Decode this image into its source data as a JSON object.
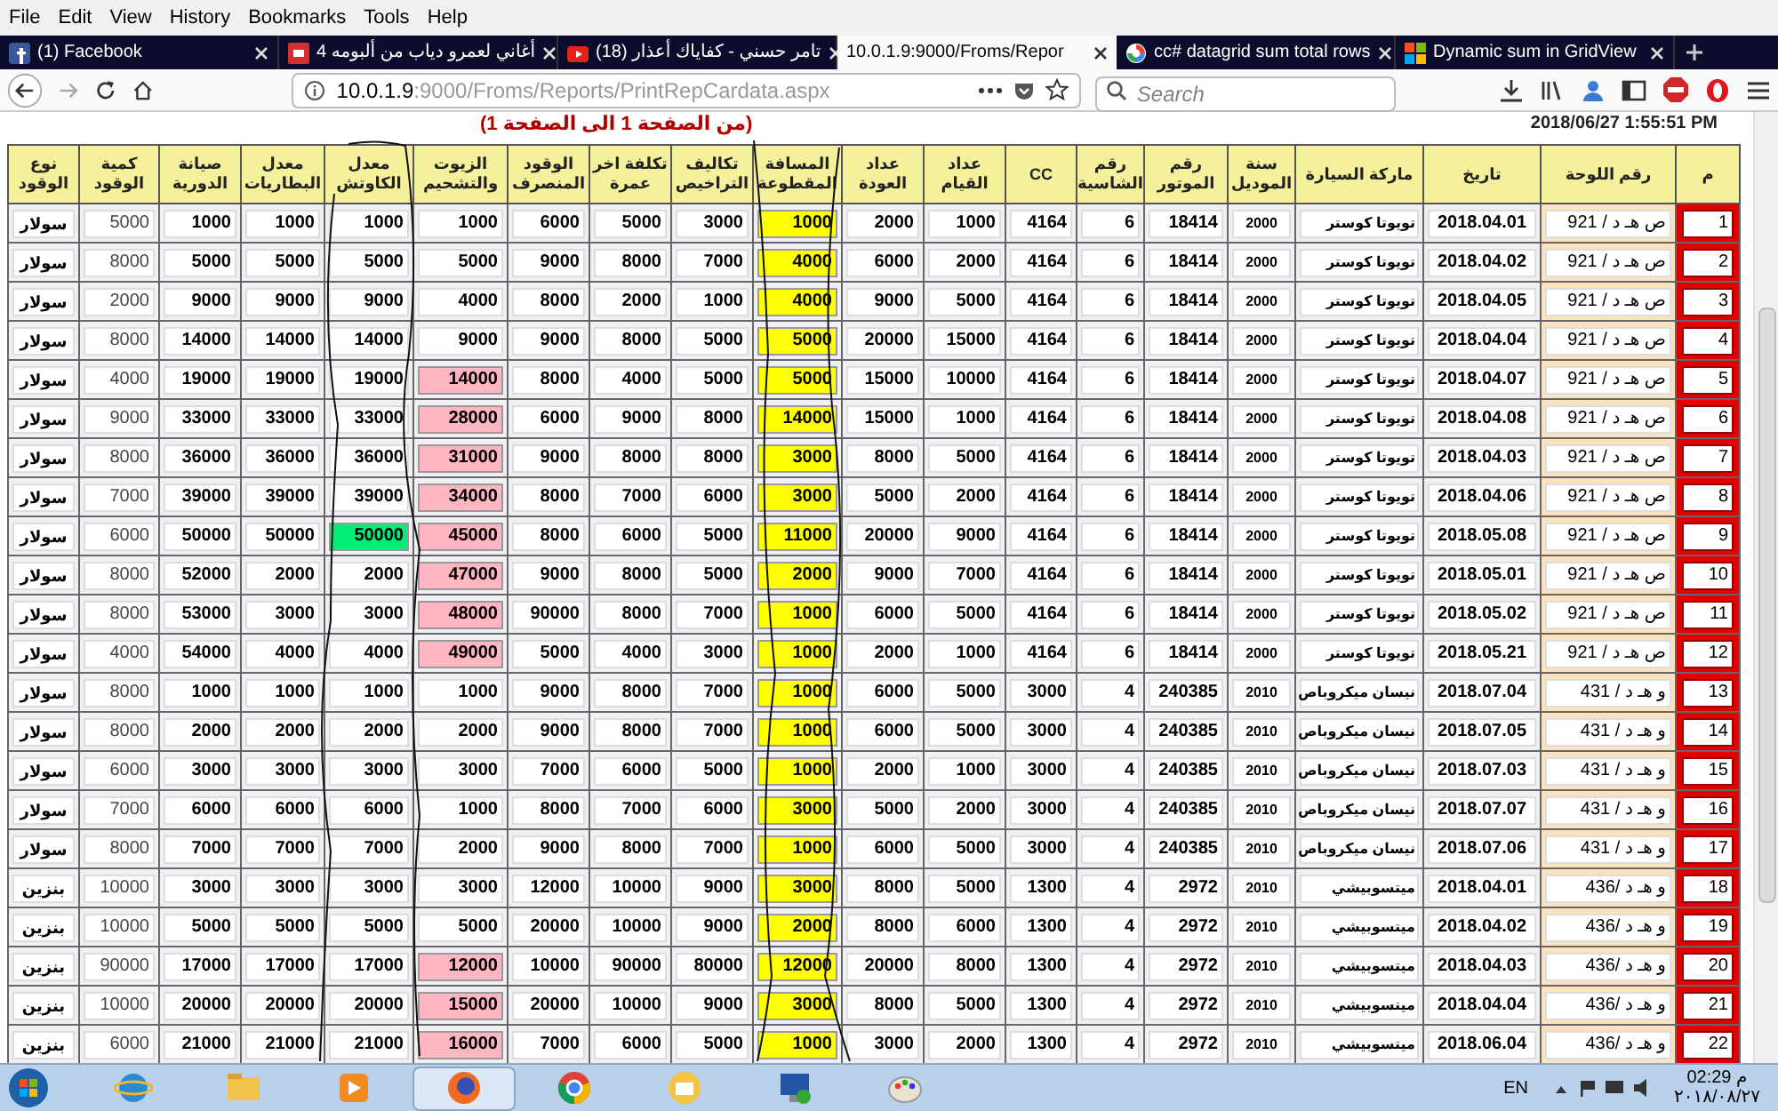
{
  "menu": [
    "File",
    "Edit",
    "View",
    "History",
    "Bookmarks",
    "Tools",
    "Help"
  ],
  "tabs": [
    {
      "label": "(1) Facebook",
      "selected": false
    },
    {
      "label": "4 أغاني لعمرو دياب من ألبومه",
      "selected": false
    },
    {
      "label": "(18) تامر حسني - كفاياك أعذار",
      "selected": false
    },
    {
      "label": "10.0.1.9:9000/Froms/Repor",
      "selected": true
    },
    {
      "label": "cc# datagrid sum total rows",
      "selected": false
    },
    {
      "label": "Dynamic sum in GridView",
      "selected": false
    }
  ],
  "address": {
    "host": "10.0.1.9",
    "rest": ":9000/Froms/Reports/PrintRepCardata.aspx"
  },
  "search": {
    "placeholder": "Search"
  },
  "report": {
    "page_range": "(من الصفحة 1 الى الصفحة 1)",
    "printed_at": "2018/06/27 1:55:51 PM"
  },
  "table": {
    "columns": [
      {
        "label": "نوع الوقود",
        "kind": "fuel"
      },
      {
        "label": "كمية الوقود",
        "kind": "plain"
      },
      {
        "label": "صيانة الدورية",
        "kind": "number"
      },
      {
        "label": "معدل البطاريات",
        "kind": "number"
      },
      {
        "label": "معدل الكاوتش",
        "kind": "tire"
      },
      {
        "label": "الزيوت والتشحيم",
        "kind": "oil"
      },
      {
        "label": "الوقود المنصرف",
        "kind": "number"
      },
      {
        "label": "تكلفة اخر عمرة",
        "kind": "number"
      },
      {
        "label": "تكاليف التراخيص",
        "kind": "number"
      },
      {
        "label": "المسافة المقطوعة",
        "kind": "highlight"
      },
      {
        "label": "عداد العودة",
        "kind": "number"
      },
      {
        "label": "عداد القيام",
        "kind": "number"
      },
      {
        "label": "CC",
        "kind": "number"
      },
      {
        "label": "رقم الشاسية",
        "kind": "number"
      },
      {
        "label": "رقم الموتور",
        "kind": "number"
      },
      {
        "label": "سنة الموديل",
        "kind": "small"
      },
      {
        "label": "ماركة السيارة",
        "kind": "brand"
      },
      {
        "label": "تاريخ",
        "kind": "date"
      },
      {
        "label": "رقم اللوحة",
        "kind": "plate"
      },
      {
        "label": "م",
        "kind": "index"
      }
    ],
    "rows": [
      {
        "cells": [
          "سولار",
          "5000",
          "1000",
          "1000",
          "1000",
          "1000",
          "6000",
          "5000",
          "3000",
          "1000",
          "2000",
          "1000",
          "4164",
          "6",
          "18414",
          "2000",
          "تويوتا كوستر",
          "2018.04.01",
          "ص هـ د / 921",
          "1"
        ],
        "oil_alert": false,
        "tire_alert": false
      },
      {
        "cells": [
          "سولار",
          "8000",
          "5000",
          "5000",
          "5000",
          "5000",
          "9000",
          "8000",
          "7000",
          "4000",
          "6000",
          "2000",
          "4164",
          "6",
          "18414",
          "2000",
          "تويوتا كوستر",
          "2018.04.02",
          "ص هـ د / 921",
          "2"
        ],
        "oil_alert": false,
        "tire_alert": false
      },
      {
        "cells": [
          "سولار",
          "2000",
          "9000",
          "9000",
          "9000",
          "4000",
          "8000",
          "2000",
          "1000",
          "4000",
          "9000",
          "5000",
          "4164",
          "6",
          "18414",
          "2000",
          "تويوتا كوستر",
          "2018.04.05",
          "ص هـ د / 921",
          "3"
        ],
        "oil_alert": false,
        "tire_alert": false
      },
      {
        "cells": [
          "سولار",
          "8000",
          "14000",
          "14000",
          "14000",
          "9000",
          "9000",
          "8000",
          "5000",
          "5000",
          "20000",
          "15000",
          "4164",
          "6",
          "18414",
          "2000",
          "تويوتا كوستر",
          "2018.04.04",
          "ص هـ د / 921",
          "4"
        ],
        "oil_alert": false,
        "tire_alert": false
      },
      {
        "cells": [
          "سولار",
          "4000",
          "19000",
          "19000",
          "19000",
          "14000",
          "8000",
          "4000",
          "5000",
          "5000",
          "15000",
          "10000",
          "4164",
          "6",
          "18414",
          "2000",
          "تويوتا كوستر",
          "2018.04.07",
          "ص هـ د / 921",
          "5"
        ],
        "oil_alert": true,
        "tire_alert": false
      },
      {
        "cells": [
          "سولار",
          "9000",
          "33000",
          "33000",
          "33000",
          "28000",
          "6000",
          "9000",
          "8000",
          "14000",
          "15000",
          "1000",
          "4164",
          "6",
          "18414",
          "2000",
          "تويوتا كوستر",
          "2018.04.08",
          "ص هـ د / 921",
          "6"
        ],
        "oil_alert": true,
        "tire_alert": false
      },
      {
        "cells": [
          "سولار",
          "8000",
          "36000",
          "36000",
          "36000",
          "31000",
          "9000",
          "8000",
          "8000",
          "3000",
          "8000",
          "5000",
          "4164",
          "6",
          "18414",
          "2000",
          "تويوتا كوستر",
          "2018.04.03",
          "ص هـ د / 921",
          "7"
        ],
        "oil_alert": true,
        "tire_alert": false
      },
      {
        "cells": [
          "سولار",
          "7000",
          "39000",
          "39000",
          "39000",
          "34000",
          "8000",
          "7000",
          "6000",
          "3000",
          "5000",
          "2000",
          "4164",
          "6",
          "18414",
          "2000",
          "تويوتا كوستر",
          "2018.04.06",
          "ص هـ د / 921",
          "8"
        ],
        "oil_alert": true,
        "tire_alert": false
      },
      {
        "cells": [
          "سولار",
          "6000",
          "50000",
          "50000",
          "50000",
          "45000",
          "8000",
          "6000",
          "5000",
          "11000",
          "20000",
          "9000",
          "4164",
          "6",
          "18414",
          "2000",
          "تويوتا كوستر",
          "2018.05.08",
          "ص هـ د / 921",
          "9"
        ],
        "oil_alert": true,
        "tire_alert": true
      },
      {
        "cells": [
          "سولار",
          "8000",
          "52000",
          "2000",
          "2000",
          "47000",
          "9000",
          "8000",
          "5000",
          "2000",
          "9000",
          "7000",
          "4164",
          "6",
          "18414",
          "2000",
          "تويوتا كوستر",
          "2018.05.01",
          "ص هـ د / 921",
          "10"
        ],
        "oil_alert": true,
        "tire_alert": false
      },
      {
        "cells": [
          "سولار",
          "8000",
          "53000",
          "3000",
          "3000",
          "48000",
          "90000",
          "8000",
          "7000",
          "1000",
          "6000",
          "5000",
          "4164",
          "6",
          "18414",
          "2000",
          "تويوتا كوستر",
          "2018.05.02",
          "ص هـ د / 921",
          "11"
        ],
        "oil_alert": true,
        "tire_alert": false
      },
      {
        "cells": [
          "سولار",
          "4000",
          "54000",
          "4000",
          "4000",
          "49000",
          "5000",
          "4000",
          "3000",
          "1000",
          "2000",
          "1000",
          "4164",
          "6",
          "18414",
          "2000",
          "تويوتا كوستر",
          "2018.05.21",
          "ص هـ د / 921",
          "12"
        ],
        "oil_alert": true,
        "tire_alert": false
      },
      {
        "cells": [
          "سولار",
          "8000",
          "1000",
          "1000",
          "1000",
          "1000",
          "9000",
          "8000",
          "7000",
          "1000",
          "6000",
          "5000",
          "3000",
          "4",
          "240385",
          "2010",
          "نيسان ميكروباص",
          "2018.07.04",
          "و هـ د / 431",
          "13"
        ],
        "oil_alert": false,
        "tire_alert": false
      },
      {
        "cells": [
          "سولار",
          "8000",
          "2000",
          "2000",
          "2000",
          "2000",
          "9000",
          "8000",
          "7000",
          "1000",
          "6000",
          "5000",
          "3000",
          "4",
          "240385",
          "2010",
          "نيسان ميكروباص",
          "2018.07.05",
          "و هـ د / 431",
          "14"
        ],
        "oil_alert": false,
        "tire_alert": false
      },
      {
        "cells": [
          "سولار",
          "6000",
          "3000",
          "3000",
          "3000",
          "3000",
          "7000",
          "6000",
          "5000",
          "1000",
          "2000",
          "1000",
          "3000",
          "4",
          "240385",
          "2010",
          "نيسان ميكروباص",
          "2018.07.03",
          "و هـ د / 431",
          "15"
        ],
        "oil_alert": false,
        "tire_alert": false
      },
      {
        "cells": [
          "سولار",
          "7000",
          "6000",
          "6000",
          "6000",
          "1000",
          "8000",
          "7000",
          "6000",
          "3000",
          "5000",
          "2000",
          "3000",
          "4",
          "240385",
          "2010",
          "نيسان ميكروباص",
          "2018.07.07",
          "و هـ د / 431",
          "16"
        ],
        "oil_alert": false,
        "tire_alert": false
      },
      {
        "cells": [
          "سولار",
          "8000",
          "7000",
          "7000",
          "7000",
          "2000",
          "9000",
          "8000",
          "7000",
          "1000",
          "6000",
          "5000",
          "3000",
          "4",
          "240385",
          "2010",
          "نيسان ميكروباص",
          "2018.07.06",
          "و هـ د / 431",
          "17"
        ],
        "oil_alert": false,
        "tire_alert": false
      },
      {
        "cells": [
          "بنزين",
          "10000",
          "3000",
          "3000",
          "3000",
          "3000",
          "12000",
          "10000",
          "9000",
          "3000",
          "8000",
          "5000",
          "1300",
          "4",
          "2972",
          "2010",
          "ميتسوبيشي",
          "2018.04.01",
          "و هـ د /436",
          "18"
        ],
        "oil_alert": false,
        "tire_alert": false
      },
      {
        "cells": [
          "بنزين",
          "10000",
          "5000",
          "5000",
          "5000",
          "5000",
          "20000",
          "10000",
          "9000",
          "2000",
          "8000",
          "6000",
          "1300",
          "4",
          "2972",
          "2010",
          "ميتسوبيشي",
          "2018.04.02",
          "و هـ د /436",
          "19"
        ],
        "oil_alert": false,
        "tire_alert": false
      },
      {
        "cells": [
          "بنزين",
          "90000",
          "17000",
          "17000",
          "17000",
          "12000",
          "10000",
          "90000",
          "80000",
          "12000",
          "20000",
          "8000",
          "1300",
          "4",
          "2972",
          "2010",
          "ميتسوبيشي",
          "2018.04.03",
          "و هـ د /436",
          "20"
        ],
        "oil_alert": true,
        "tire_alert": false
      },
      {
        "cells": [
          "بنزين",
          "10000",
          "20000",
          "20000",
          "20000",
          "15000",
          "20000",
          "10000",
          "9000",
          "3000",
          "8000",
          "5000",
          "1300",
          "4",
          "2972",
          "2010",
          "ميتسوبيشي",
          "2018.04.04",
          "و هـ د /436",
          "21"
        ],
        "oil_alert": true,
        "tire_alert": false
      },
      {
        "cells": [
          "بنزين",
          "6000",
          "21000",
          "21000",
          "21000",
          "16000",
          "7000",
          "6000",
          "5000",
          "1000",
          "3000",
          "2000",
          "1300",
          "4",
          "2972",
          "2010",
          "ميتسوبيشي",
          "2018.06.04",
          "و هـ د /436",
          "22"
        ],
        "oil_alert": true,
        "tire_alert": false
      }
    ]
  },
  "taskbar": {
    "language": "EN",
    "time": "02:29 م",
    "date": "٢٠١٨/٠٨/٢٧"
  }
}
